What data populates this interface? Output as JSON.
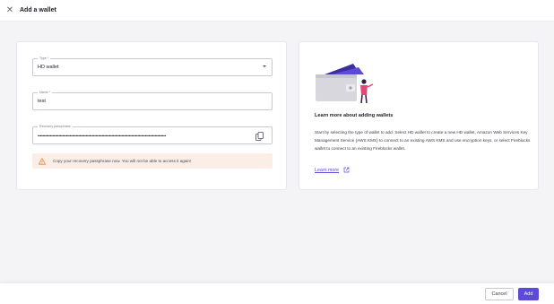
{
  "header": {
    "title": "Add a wallet",
    "close_icon": "close-icon"
  },
  "form": {
    "type": {
      "label": "Type *",
      "value": "HD wallet"
    },
    "name": {
      "label": "Name *",
      "value": "test"
    },
    "recovery": {
      "label": "Recovery passphrase",
      "value": "••••••••••••••••••••••••••••••••••••••••••••••••••••••••••••••••••••••••••••••••••••••••••••••••••••••••"
    },
    "warning": "Copy your recovery passphrase now. You will not be able to access it again!"
  },
  "info": {
    "title": "Learn more about adding wallets",
    "body": "Start by selecting the type of wallet to add. Select HD wallet to create a new HD wallet, Amazon Web Services Key Management Service (AWS KMS) to connect to an existing AWS KMS and use encryption keys, or select Fireblocks wallet to connect to an existing Fireblocks wallet.",
    "link": "Learn more"
  },
  "footer": {
    "cancel": "Cancel",
    "add": "Add"
  },
  "colors": {
    "accent": "#5b4bd8",
    "warning_bg": "#fbeee6",
    "warning_icon": "#e8893a"
  }
}
